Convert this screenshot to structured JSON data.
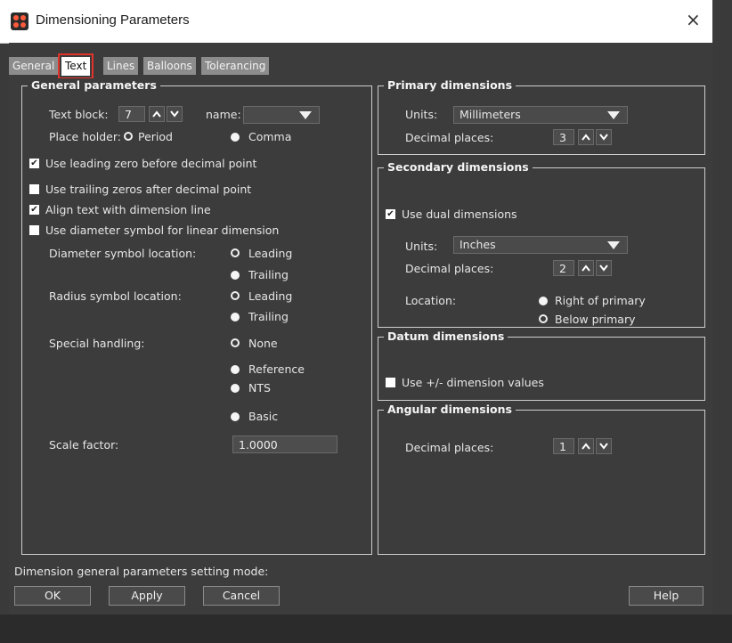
{
  "window": {
    "title": "Dimensioning Parameters",
    "close_label": "×"
  },
  "tabs": [
    "General",
    "Text",
    "Lines",
    "Balloons",
    "Tolerancing"
  ],
  "general": {
    "title": "General parameters",
    "text_block_label": "Text block:",
    "text_block_value": "7",
    "name_label": "name:",
    "name_value": "",
    "place_holder_label": "Place holder:",
    "period_label": "Period",
    "comma_label": "Comma",
    "leading_zero_label": "Use leading zero before decimal point",
    "trailing_zeros_label": "Use trailing zeros after decimal point",
    "align_text_label": "Align text with dimension line",
    "diameter_symbol_label": "Use diameter symbol for linear dimension",
    "diameter_location_label": "Diameter symbol location:",
    "radius_location_label": "Radius symbol location:",
    "leading_label": "Leading",
    "trailing_label": "Trailing",
    "special_handling_label": "Special handling:",
    "none_label": "None",
    "reference_label": "Reference",
    "nts_label": "NTS",
    "basic_label": "Basic",
    "scale_factor_label": "Scale factor:",
    "scale_factor_value": "1.0000"
  },
  "primary": {
    "title": "Primary dimensions",
    "units_label": "Units:",
    "units_value": "Millimeters",
    "decimal_label": "Decimal places:",
    "decimal_value": "3"
  },
  "secondary": {
    "title": "Secondary dimensions",
    "dual_label": "Use dual dimensions",
    "units_label": "Units:",
    "units_value": "Inches",
    "decimal_label": "Decimal places:",
    "decimal_value": "2",
    "location_label": "Location:",
    "right_label": "Right of primary",
    "below_label": "Below primary"
  },
  "datum": {
    "title": "Datum dimensions",
    "plusminus_label": "Use +/- dimension values"
  },
  "angular": {
    "title": "Angular dimensions",
    "decimal_label": "Decimal places:",
    "decimal_value": "1"
  },
  "status_text": "Dimension general parameters setting mode:",
  "buttons": {
    "ok": "OK",
    "apply": "Apply",
    "cancel": "Cancel",
    "help": "Help"
  },
  "check_mark": "✔"
}
